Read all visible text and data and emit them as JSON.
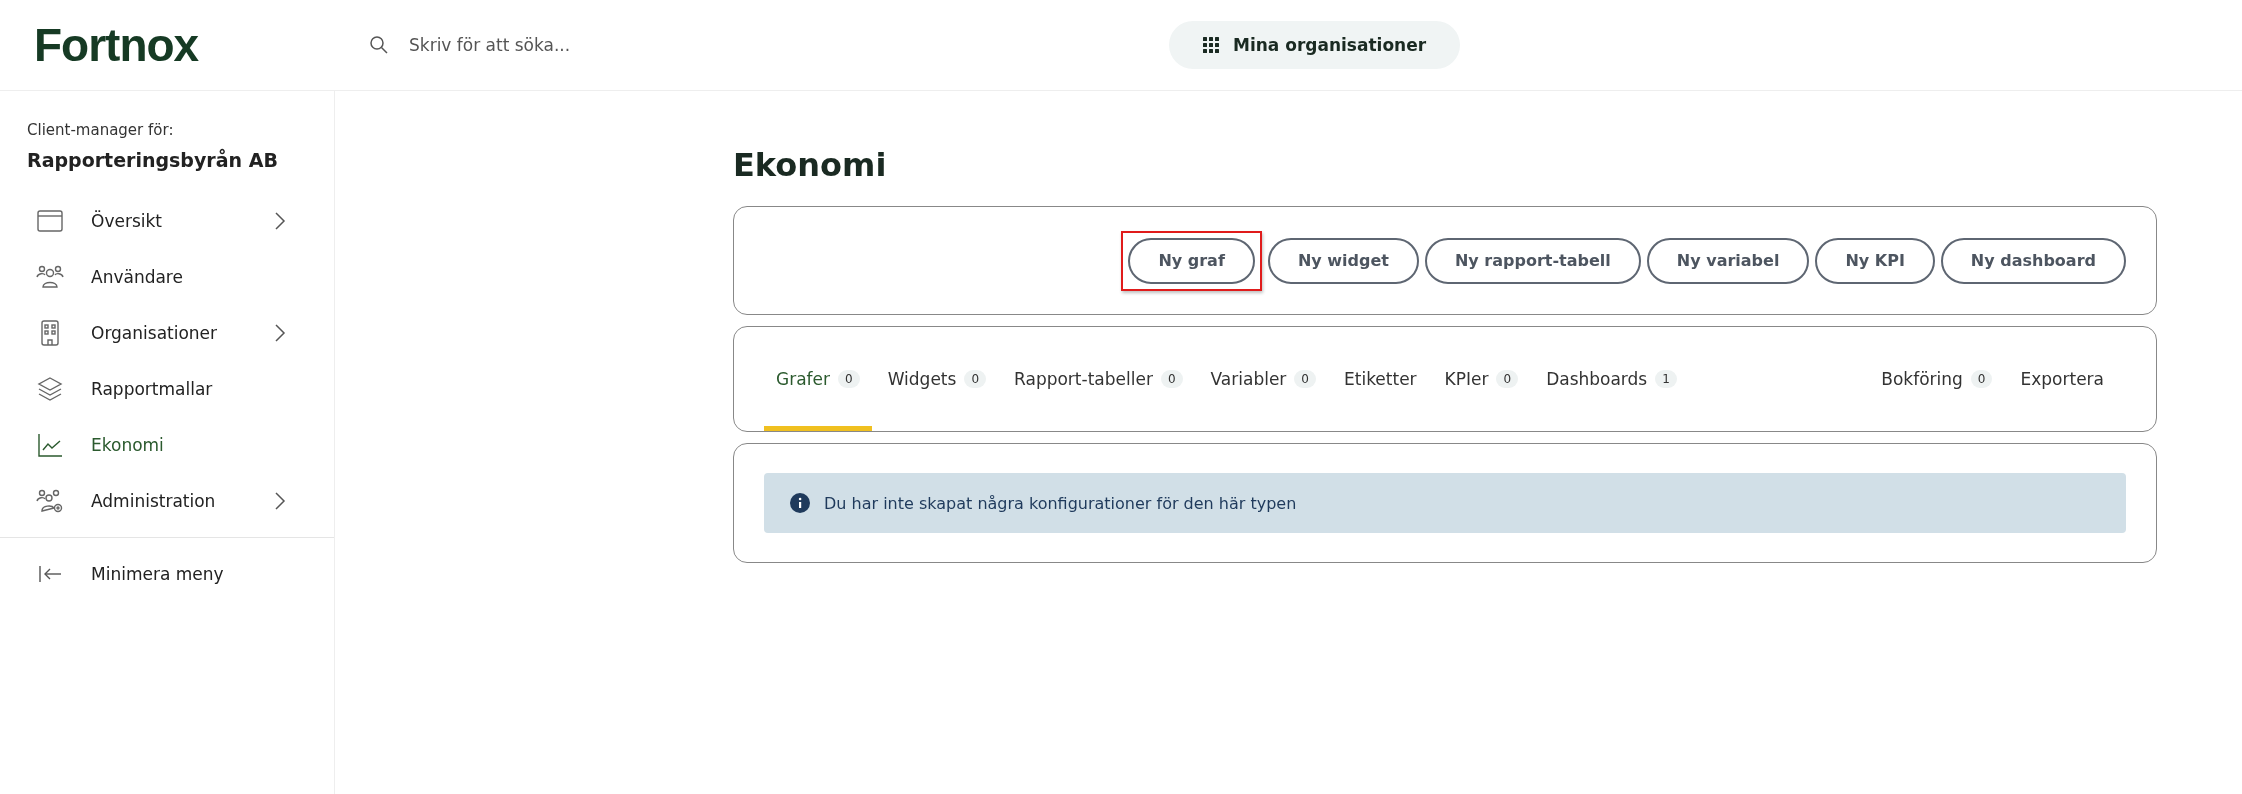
{
  "header": {
    "logo": "Fortnox",
    "search": {
      "placeholder": "Skriv för att söka..."
    },
    "org_button": "Mina organisationer"
  },
  "sidebar": {
    "caption": "Client-manager för:",
    "company": "Rapporteringsbyrån AB",
    "items": [
      {
        "kind": "window",
        "label": "Översikt",
        "selected": false,
        "expandable": true
      },
      {
        "kind": "users",
        "label": "Användare",
        "selected": false,
        "expandable": false
      },
      {
        "kind": "building",
        "label": "Organisationer",
        "selected": false,
        "expandable": true
      },
      {
        "kind": "layers",
        "label": "Rapportmallar",
        "selected": false,
        "expandable": false
      },
      {
        "kind": "chart",
        "label": "Ekonomi",
        "selected": true,
        "expandable": false
      },
      {
        "kind": "admin",
        "label": "Administration",
        "selected": false,
        "expandable": true
      }
    ],
    "collapse": "Minimera meny"
  },
  "page": {
    "title": "Ekonomi",
    "actions": [
      {
        "label": "Ny graf",
        "highlighted": true
      },
      {
        "label": "Ny widget",
        "highlighted": false
      },
      {
        "label": "Ny rapport-tabell",
        "highlighted": false
      },
      {
        "label": "Ny variabel",
        "highlighted": false
      },
      {
        "label": "Ny KPI",
        "highlighted": false
      },
      {
        "label": "Ny dashboard",
        "highlighted": false
      }
    ],
    "tabs": [
      {
        "label": "Grafer",
        "count": "0",
        "selected": true
      },
      {
        "label": "Widgets",
        "count": "0",
        "selected": false
      },
      {
        "label": "Rapport-tabeller",
        "count": "0",
        "selected": false
      },
      {
        "label": "Variabler",
        "count": "0",
        "selected": false
      },
      {
        "label": "Etiketter",
        "selected": false
      },
      {
        "label": "KPIer",
        "count": "0",
        "selected": false
      },
      {
        "label": "Dashboards",
        "count": "1",
        "selected": false
      }
    ],
    "right_tabs": [
      {
        "label": "Bokföring",
        "count": "0",
        "selected": false
      },
      {
        "label": "Exportera",
        "selected": false
      }
    ],
    "info": "Du har inte skapat några konfigurationer för den här typen"
  }
}
